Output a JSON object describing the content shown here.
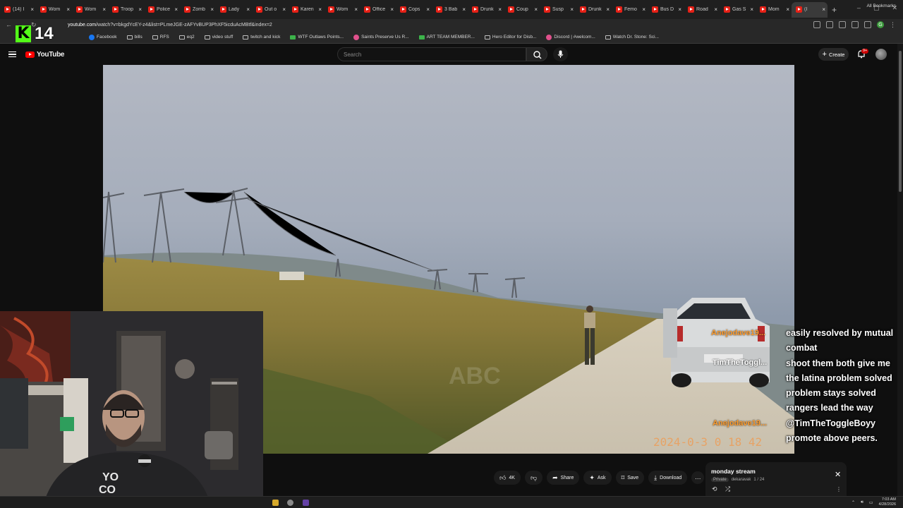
{
  "browser": {
    "tabs": [
      {
        "label": "(14) I"
      },
      {
        "label": "Wom"
      },
      {
        "label": "Wom"
      },
      {
        "label": "Troop"
      },
      {
        "label": "Police"
      },
      {
        "label": "Zomb"
      },
      {
        "label": "Lady"
      },
      {
        "label": "Out o"
      },
      {
        "label": "Karen"
      },
      {
        "label": "Wom"
      },
      {
        "label": "Office"
      },
      {
        "label": "Cops"
      },
      {
        "label": "3 Bab"
      },
      {
        "label": "Drunk"
      },
      {
        "label": "Coup"
      },
      {
        "label": "Susp"
      },
      {
        "label": "Drunk"
      },
      {
        "label": "Femo"
      },
      {
        "label": "Bus D"
      },
      {
        "label": "Road"
      },
      {
        "label": "Gas S"
      },
      {
        "label": "Mom"
      },
      {
        "label": "(I"
      }
    ],
    "new_tab_glyph": "+",
    "url_host": "youtube.com",
    "url_path": "/watch?v=bkgdYcEY-z4&list=PLmeJGE-zAFYvBUP3PhXF5icduAcMBtf&index=2",
    "bookmarks": [
      {
        "label": "Facebook",
        "icon": "facebook-icon"
      },
      {
        "label": "bills",
        "icon": "folder-icon"
      },
      {
        "label": "RFS",
        "icon": "folder-icon"
      },
      {
        "label": "eq2",
        "icon": "folder-icon"
      },
      {
        "label": "video stuff",
        "icon": "folder-icon"
      },
      {
        "label": "twitch and kick",
        "icon": "folder-icon"
      },
      {
        "label": "WTF Outlaws Points...",
        "icon": "green-icon"
      },
      {
        "label": "Saints Preserve Us R...",
        "icon": "pink-icon"
      },
      {
        "label": "ART TEAM MEMBER...",
        "icon": "green-icon"
      },
      {
        "label": "Hero Editor for Disb...",
        "icon": "page-icon"
      },
      {
        "label": "Discord | #welcom...",
        "icon": "discord-icon"
      },
      {
        "label": "Watch Dr. Stone: Sci...",
        "icon": "page-icon"
      }
    ],
    "all_bookmarks": "All Bookmarks",
    "profile_letter": "G",
    "address_stuff_label": "stuff"
  },
  "overlay": {
    "kick_letter": "K",
    "count": "14"
  },
  "youtube": {
    "logo_text": "YouTube",
    "search_placeholder": "Search",
    "create_label": "Create",
    "notification_badge": "9+"
  },
  "chat": {
    "names": [
      "Anejodave19...",
      "TimTheToggl...",
      "Anejodave19..."
    ],
    "messages": [
      "easily resolved by mutual",
      "combat",
      "shoot them both give me",
      "the latina problem solved",
      "problem stays solved",
      "rangers lead the way",
      "@TimTheToggleBoyy",
      "promote above peers."
    ]
  },
  "video": {
    "timestamp": "2024-0-3  0 18 42",
    "watermark": "ABC"
  },
  "actions": {
    "like_count": "4K",
    "share": "Share",
    "ask": "Ask",
    "save": "Save",
    "download": "Download"
  },
  "playlist": {
    "title": "monday stream",
    "privacy": "Private",
    "owner": "dekaravak",
    "position": "1 / 24"
  },
  "taskbar": {
    "time": "7:03 AM",
    "date": "4/28/2026"
  },
  "colors": {
    "youtube_red": "#ff0000",
    "chat_name_orange": "#ff9d2e",
    "kick_green": "#53fc18"
  }
}
